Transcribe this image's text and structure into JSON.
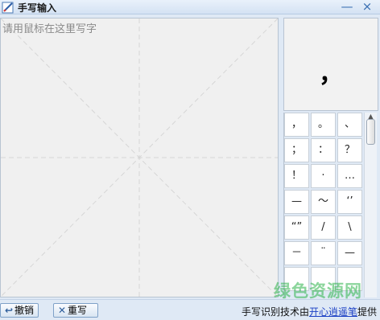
{
  "window": {
    "title": "手写输入",
    "minimize_label": "—",
    "close_label": "×"
  },
  "canvas": {
    "hint": "请用鼠标在这里写字"
  },
  "preview": {
    "character": "，"
  },
  "candidates": [
    [
      "，",
      "。",
      "、"
    ],
    [
      "；",
      "：",
      "？"
    ],
    [
      "！",
      "·",
      "…"
    ],
    [
      "—",
      "～",
      "‘’"
    ],
    [
      "“”",
      "/",
      "\\"
    ],
    [
      "－",
      "¨",
      "—"
    ],
    [
      "",
      "",
      ""
    ]
  ],
  "buttons": {
    "undo": "撤销",
    "rewrite": "重写"
  },
  "credit": {
    "prefix": "手写识别技术由",
    "link": "开心逍遥笔",
    "suffix": "提供"
  },
  "watermark": "绿色资源网",
  "colors": {
    "link": "#1a3fc4",
    "watermark": "#2db44a"
  }
}
